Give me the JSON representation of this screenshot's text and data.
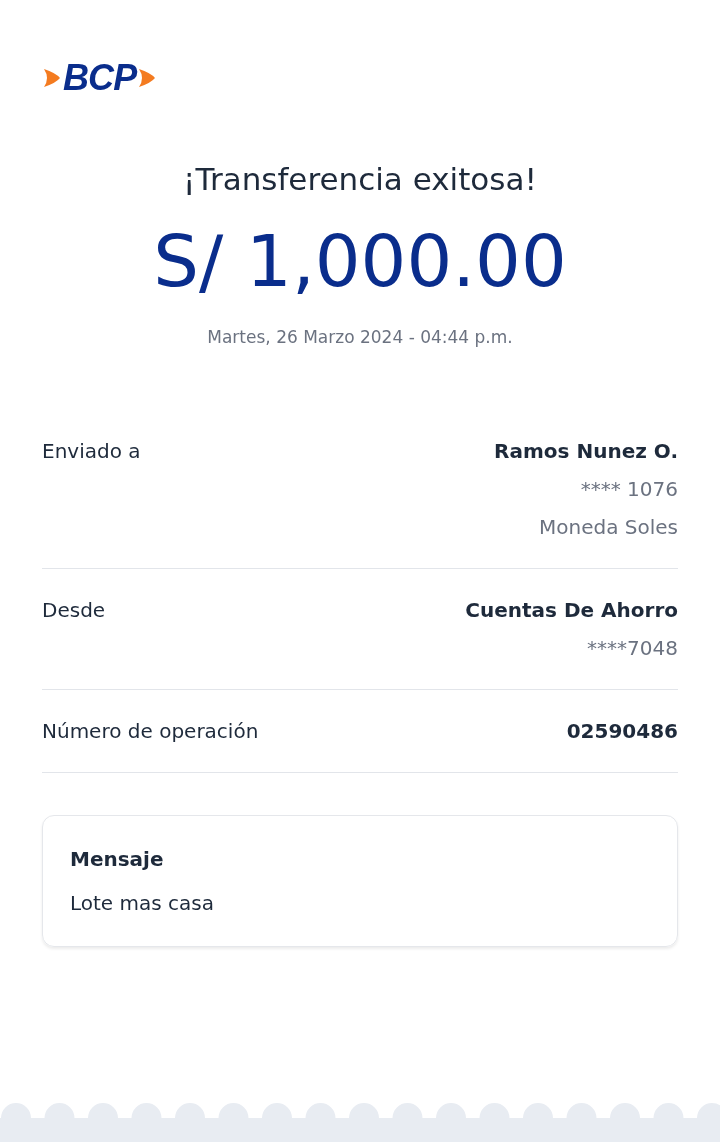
{
  "logo": {
    "text": "BCP"
  },
  "title": "¡Transferencia exitosa!",
  "amount": "S/ 1,000.00",
  "date": "Martes, 26 Marzo 2024 - 04:44 p.m.",
  "details": [
    {
      "label": "Enviado a",
      "values": [
        {
          "text": "Ramos Nunez O.",
          "bold": true
        },
        {
          "text": "**** 1076",
          "bold": false
        },
        {
          "text": "Moneda Soles",
          "bold": false
        }
      ]
    },
    {
      "label": "Desde",
      "values": [
        {
          "text": "Cuentas De Ahorro",
          "bold": true
        },
        {
          "text": "****7048",
          "bold": false
        }
      ]
    },
    {
      "label": "Número de operación",
      "values": [
        {
          "text": "02590486",
          "bold": true
        }
      ]
    }
  ],
  "message": {
    "title": "Mensaje",
    "text": "Lote mas casa"
  }
}
